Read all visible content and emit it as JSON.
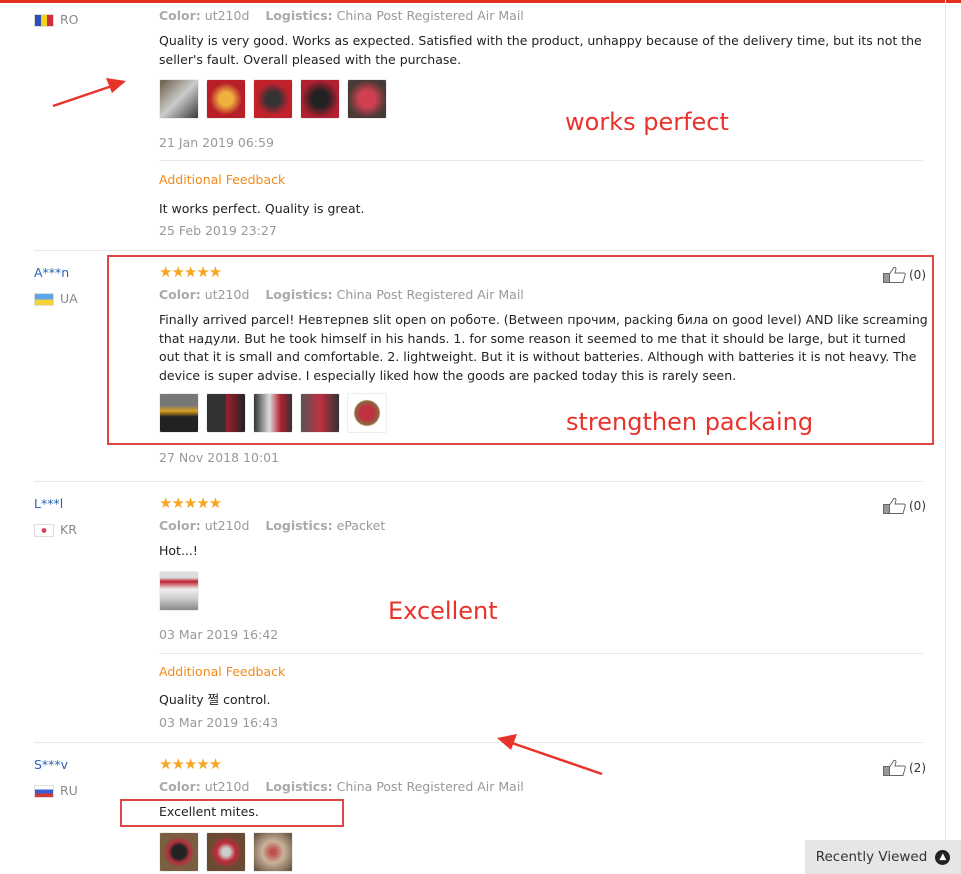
{
  "labels": {
    "color": "Color:",
    "logistics": "Logistics:",
    "additional": "Additional Feedback"
  },
  "reviews": [
    {
      "user": "",
      "country": "RO",
      "flag_colors": [
        "#2f4fb3",
        "#f2d21b",
        "#d0303a"
      ],
      "color": "ut210d",
      "logistics": "China Post Registered Air Mail",
      "text": "Quality is very good. Works as expected. Satisfied with the product, unhappy because of the delivery time, but its not the seller's fault. Overall pleased with the purchase.",
      "photos": 5,
      "date": "21 Jan 2019 06:59",
      "additional_text": "It works perfect. Quality is great.",
      "additional_date": "25 Feb 2019 23:27"
    },
    {
      "user": "A***n",
      "country": "UA",
      "flag_colors": [
        "#5aa6e8",
        "#f5d33a"
      ],
      "stars": "★★★★★",
      "rating": 5,
      "likes": "(0)",
      "color": "ut210d",
      "logistics": "China Post Registered Air Mail",
      "text": "Finally arrived parcel! Невтерпев slit open on роботе. (Between прочим, packing била on good level) AND like screaming that надули. But he took himself in his hands. 1. for some reason it seemed to me that it should be large, but it turned out that it is small and comfortable. 2. lightweight. But it is without batteries. Although with batteries it is not heavy. The device is super advise. I especially liked how the goods are packed today this is rarely seen.",
      "photos": 5,
      "date": "27 Nov 2018 10:01"
    },
    {
      "user": "L***l",
      "country": "KR",
      "stars": "★★★★★",
      "rating": 5,
      "likes": "(0)",
      "color": "ut210d",
      "logistics": "ePacket",
      "text": "Hot...!",
      "photos": 1,
      "date": "03 Mar 2019 16:42",
      "additional_text": "Quality 쩔 control.",
      "additional_date": "03 Mar 2019 16:43"
    },
    {
      "user": "S***v",
      "country": "RU",
      "flag_colors": [
        "#ffffff",
        "#3a5fcd",
        "#d23a3a"
      ],
      "stars": "★★★★★",
      "rating": 5,
      "likes": "(2)",
      "color": "ut210d",
      "logistics": "China Post Registered Air Mail",
      "text": "Excellent mites.",
      "photos": 3
    }
  ],
  "annotations": {
    "a1": "works perfect",
    "a2": "strengthen packaing",
    "a3": "Excellent",
    "color": "#e8332b"
  },
  "recently_viewed": "Recently Viewed"
}
